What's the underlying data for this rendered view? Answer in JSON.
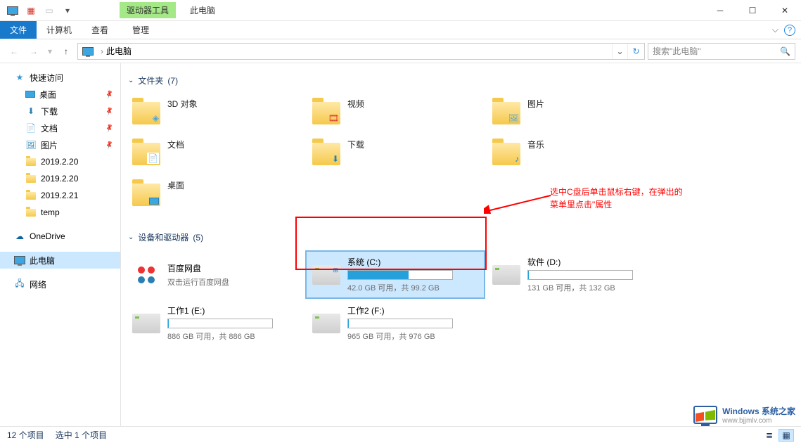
{
  "titlebar": {
    "contextual_tab": "驱动器工具",
    "window_title": "此电脑"
  },
  "ribbon": {
    "file": "文件",
    "tabs": [
      "计算机",
      "查看"
    ],
    "contextual": "管理"
  },
  "address": {
    "location": "此电脑",
    "search_placeholder": "搜索\"此电脑\""
  },
  "sidebar": {
    "quick_access": "快速访问",
    "items": [
      {
        "label": "桌面",
        "icon": "desktop",
        "pinned": true
      },
      {
        "label": "下载",
        "icon": "download",
        "pinned": true
      },
      {
        "label": "文档",
        "icon": "document",
        "pinned": true
      },
      {
        "label": "图片",
        "icon": "pictures",
        "pinned": true
      },
      {
        "label": "2019.2.20",
        "icon": "folder",
        "pinned": false
      },
      {
        "label": "2019.2.20",
        "icon": "folder",
        "pinned": false
      },
      {
        "label": "2019.2.21",
        "icon": "folder",
        "pinned": false
      },
      {
        "label": "temp",
        "icon": "folder",
        "pinned": false
      }
    ],
    "onedrive": "OneDrive",
    "this_pc": "此电脑",
    "network": "网络"
  },
  "groups": {
    "folders": {
      "label": "文件夹",
      "count": "(7)"
    },
    "devices": {
      "label": "设备和驱动器",
      "count": "(5)"
    }
  },
  "folders": [
    {
      "name": "3D 对象"
    },
    {
      "name": "视频"
    },
    {
      "name": "图片"
    },
    {
      "name": "文档"
    },
    {
      "name": "下载"
    },
    {
      "name": "音乐"
    },
    {
      "name": "桌面"
    }
  ],
  "devices": [
    {
      "name": "百度网盘",
      "sub": "双击运行百度网盘",
      "type": "app"
    },
    {
      "name": "系统 (C:)",
      "sub": "42.0 GB 可用，共 99.2 GB",
      "type": "drive",
      "fill": 58,
      "selected": true
    },
    {
      "name": "软件 (D:)",
      "sub": "131 GB 可用，共 132 GB",
      "type": "drive",
      "fill": 1
    },
    {
      "name": "工作1 (E:)",
      "sub": "886 GB 可用，共 886 GB",
      "type": "drive",
      "fill": 0
    },
    {
      "name": "工作2 (F:)",
      "sub": "965 GB 可用，共 976 GB",
      "type": "drive",
      "fill": 1
    }
  ],
  "annotation": {
    "line1": "选中C盘后单击鼠标右键，在弹出的",
    "line2": "菜单里点击\"属性"
  },
  "statusbar": {
    "count": "12 个项目",
    "selected": "选中 1 个项目"
  },
  "watermark": {
    "title": "Windows 系统之家",
    "url": "www.bjjmlv.com"
  }
}
